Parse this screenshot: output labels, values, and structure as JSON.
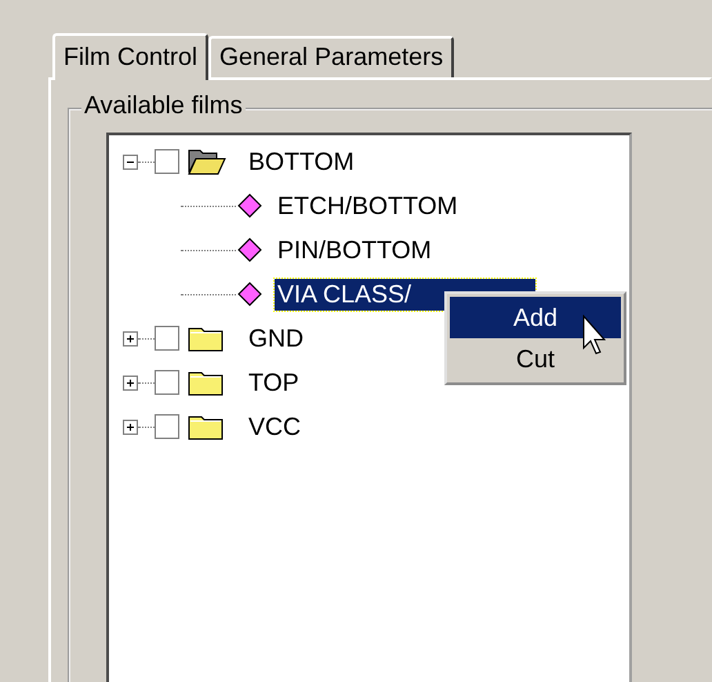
{
  "tabs": [
    {
      "label": "Film Control",
      "selected": true
    },
    {
      "label": "General Parameters",
      "selected": false
    }
  ],
  "group": {
    "title": "Available films"
  },
  "tree": [
    {
      "kind": "folder",
      "label": "BOTTOM",
      "checked": false,
      "expanded": true,
      "children": [
        {
          "kind": "film",
          "label": "ETCH/BOTTOM",
          "selected": false
        },
        {
          "kind": "film",
          "label": "PIN/BOTTOM",
          "selected": false
        },
        {
          "kind": "film",
          "label": "VIA CLASS/",
          "selected": true
        }
      ]
    },
    {
      "kind": "folder",
      "label": "GND",
      "checked": false,
      "expanded": false
    },
    {
      "kind": "folder",
      "label": "TOP",
      "checked": false,
      "expanded": false
    },
    {
      "kind": "folder",
      "label": "VCC",
      "checked": false,
      "expanded": false
    }
  ],
  "context_menu": [
    {
      "label": "Add",
      "selected": true
    },
    {
      "label": "Cut",
      "selected": false
    }
  ]
}
